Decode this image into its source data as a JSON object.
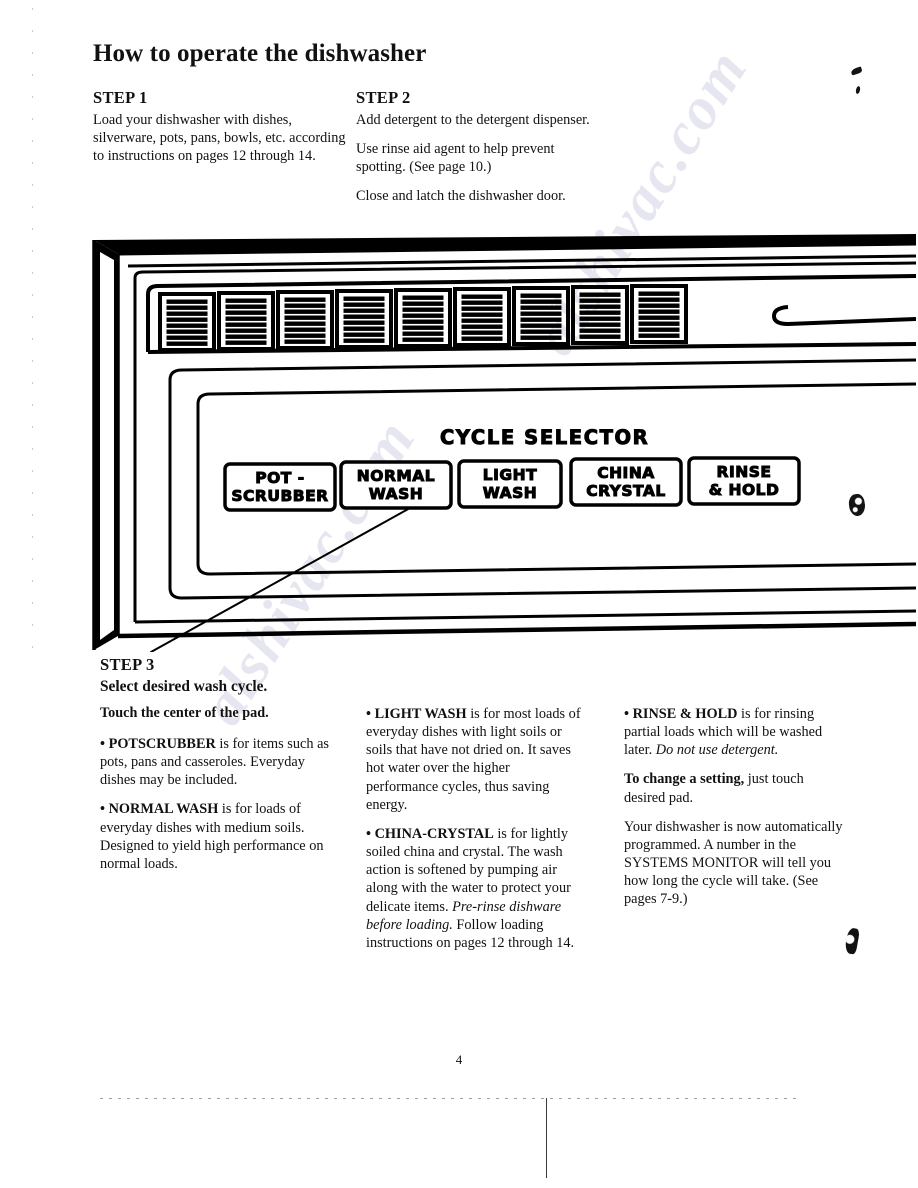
{
  "document": {
    "title": "How to operate the dishwasher",
    "page_number": "4",
    "watermark": "alshivac.com"
  },
  "steps": {
    "step1": {
      "heading": "STEP 1",
      "paragraphs": [
        "Load your dishwasher with dishes, silverware, pots, pans, bowls, etc. according to instructions on pages 12 through 14."
      ]
    },
    "step2": {
      "heading": "STEP 2",
      "paragraphs": [
        "Add detergent to the detergent dispenser.",
        "Use rinse aid agent to help prevent spotting. (See page 10.)",
        "Close and latch the dishwasher door."
      ]
    },
    "step3": {
      "heading": "STEP 3",
      "subheading": "Select desired wash cycle.",
      "instruction": "Touch the center of the pad."
    }
  },
  "control_panel": {
    "section_label": "CYCLE SELECTOR",
    "vent_count": 9,
    "vent_slats_per_segment": 9,
    "buttons": [
      {
        "line1": "POT -",
        "line2": "SCRUBBER"
      },
      {
        "line1": "NORMAL",
        "line2": "WASH"
      },
      {
        "line1": "LIGHT",
        "line2": "WASH"
      },
      {
        "line1": "CHINA",
        "line2": "CRYSTAL"
      },
      {
        "line1": "RINSE",
        "line2": "& HOLD"
      }
    ]
  },
  "cycle_descriptions": {
    "column_left": [
      {
        "term": "• POTSCRUBBER",
        "rest": " is for items such as pots, pans and casseroles. Everyday dishes may be included."
      },
      {
        "term": "• NORMAL WASH",
        "rest": " is for loads of everyday dishes with medium soils. Designed to yield high performance on normal loads."
      }
    ],
    "column_middle": [
      {
        "term": "• LIGHT WASH",
        "rest": " is for most loads of everyday dishes with light soils or soils that have not dried on. It saves hot water over the higher performance cycles, thus saving energy."
      },
      {
        "term": "• CHINA-CRYSTAL",
        "rest_a": " is for lightly soiled china and crystal. The wash action is softened by pumping air along with the water to protect your delicate items. ",
        "italic": "Pre-rinse dishware before loading.",
        "rest_b": " Follow loading instructions on pages 12 through 14."
      }
    ],
    "column_right": [
      {
        "term": "• RINSE & HOLD",
        "rest_a": " is for rinsing partial loads which will be washed later. ",
        "italic": "Do not use detergent.",
        "rest_b": ""
      }
    ],
    "change_setting": {
      "term": "To change a setting,",
      "rest": " just touch desired pad."
    },
    "closing": "Your dishwasher is now automatically programmed. A number in the SYSTEMS MONITOR will tell you how long the cycle will take. (See pages 7-9.)"
  }
}
